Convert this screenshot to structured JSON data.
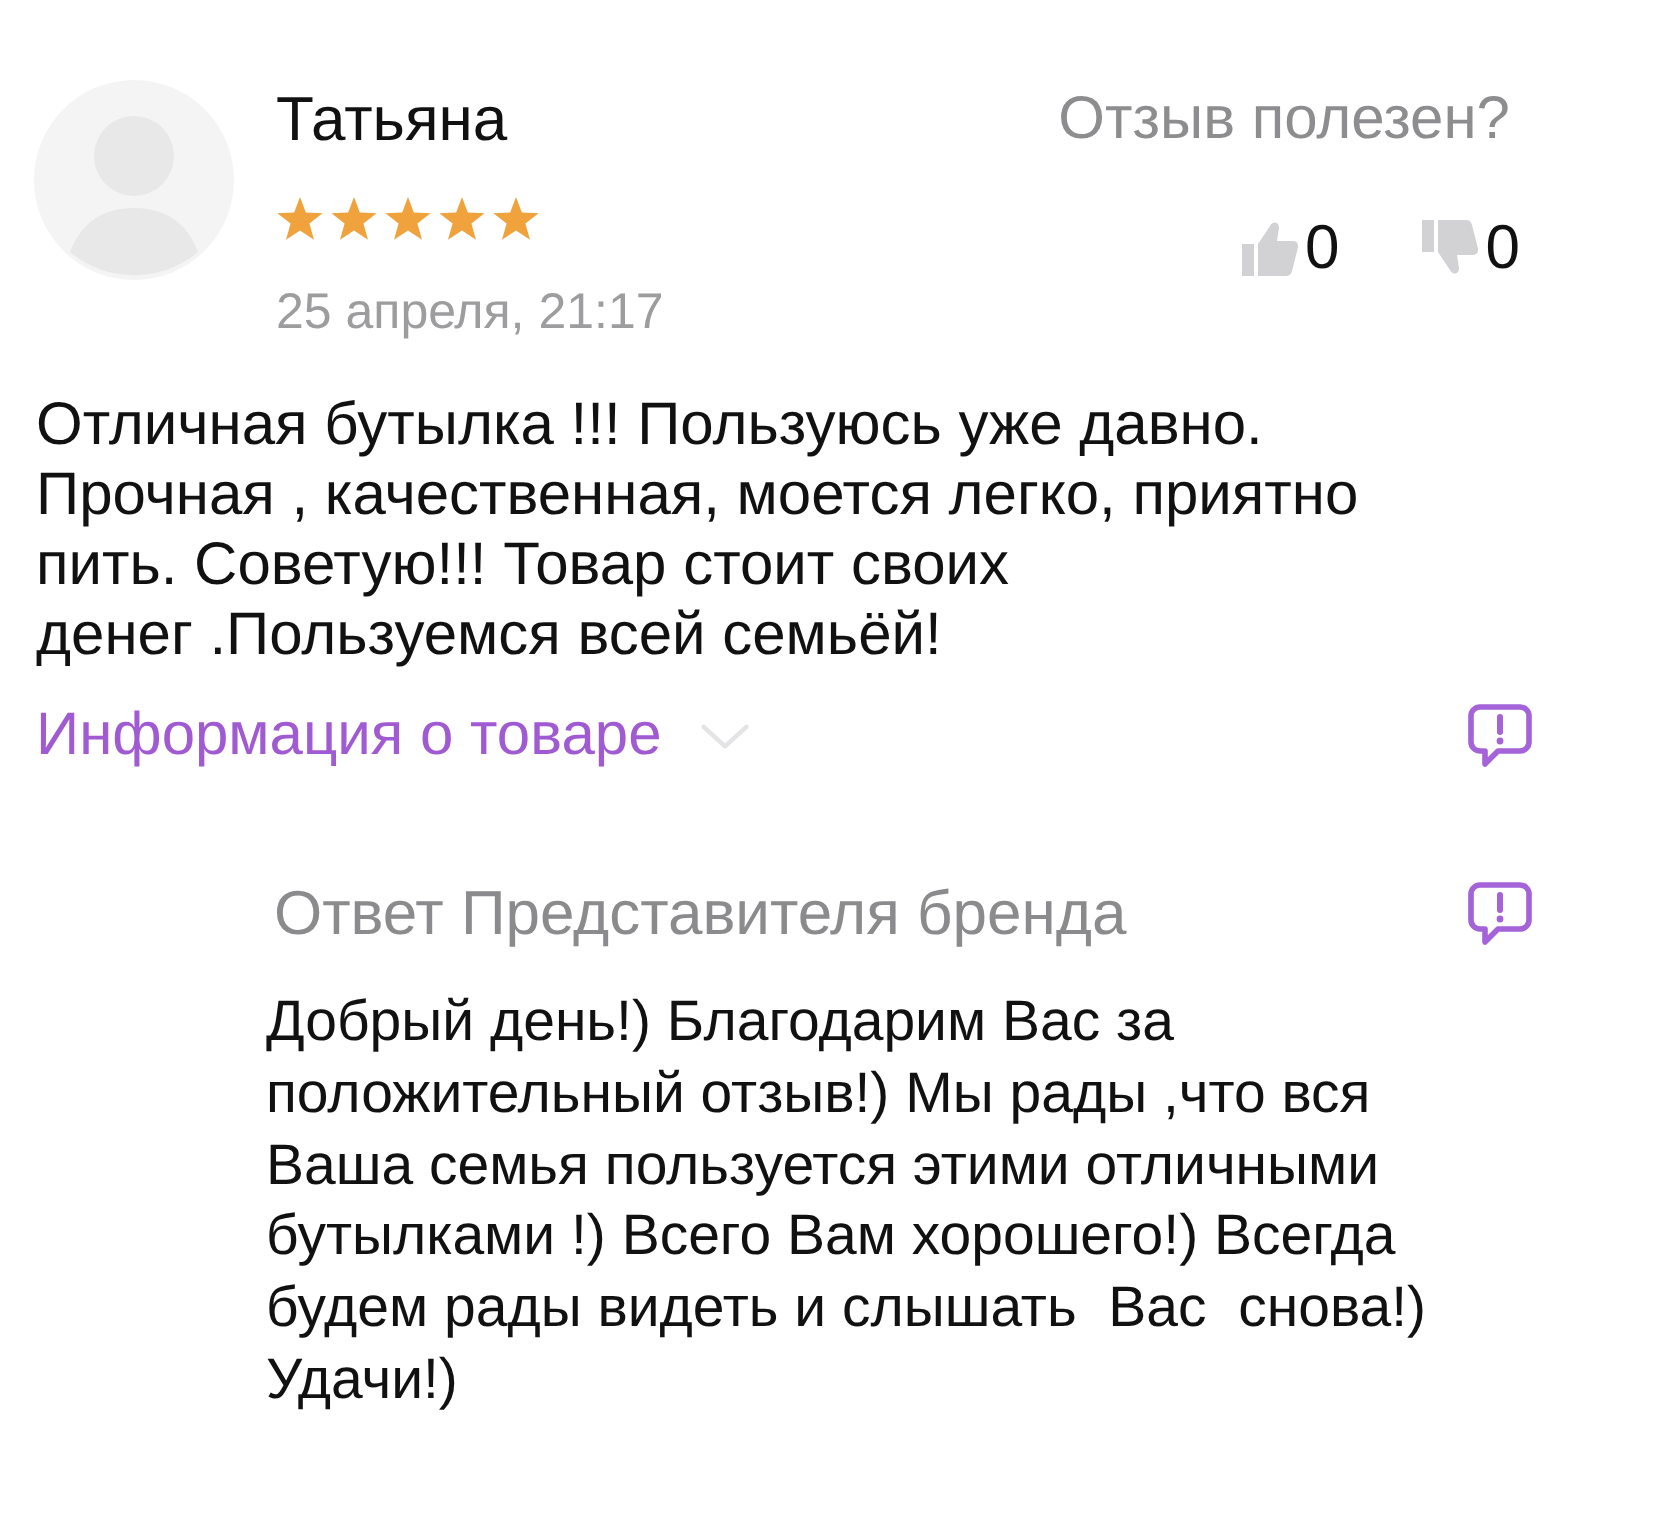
{
  "review": {
    "author": "Татьяна",
    "stars": 5,
    "date": "25 апреля, 21:17",
    "helpful_prompt": "Отзыв полезен?",
    "likes": "0",
    "dislikes": "0",
    "text": "Отличная бутылка !!! Пользуюсь уже давно. Прочная , качественная, моется легко, приятно пить. Советую!!! Товар стоит своих\nденег .Пользуемся всей семьёй!",
    "product_info": {
      "label": "Информация о товаре",
      "expanded": false
    }
  },
  "brand_reply": {
    "title": "Ответ Представителя бренда",
    "text": "Добрый день!) Благодарим Вас за положительный отзыв!) Мы рады ,что вся Ваша семья пользуется этими отличными бутылками !) Всего Вам хорошего!) Всегда будем рады видеть и слышать  Вас  снова!) Удачи!)"
  }
}
